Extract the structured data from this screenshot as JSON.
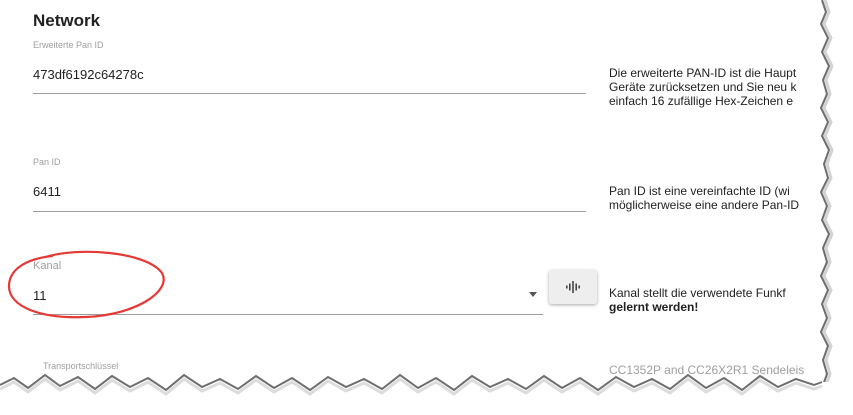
{
  "section": {
    "title": "Network"
  },
  "fields": {
    "extended_pan_id": {
      "label": "Erweiterte Pan ID",
      "value": "473df6192c64278c",
      "description_lines": [
        "Die erweiterte PAN-ID ist die Haupt",
        "Geräte zurücksetzen und Sie neu k",
        "einfach 16 zufällige Hex-Zeichen e"
      ]
    },
    "pan_id": {
      "label": "Pan ID",
      "value": "6411",
      "description_lines": [
        "Pan ID ist eine vereinfachte ID (wi",
        "möglicherweise eine andere Pan-ID"
      ]
    },
    "kanal": {
      "label": "Kanal",
      "selected": "11",
      "description_line1": "Kanal stellt die verwendete Funkf",
      "description_line2_bold": "gelernt werden!"
    },
    "transport_key": {
      "label": "Transportschlüssel",
      "description": "CC1352P and CC26X2R1 Sendeleis"
    }
  },
  "icons": {
    "scan_button": "channel-scan-icon",
    "dropdown": "caret-down-icon"
  },
  "colors": {
    "highlight": "#e53935",
    "label": "#9e9e9e",
    "text": "#212121"
  }
}
